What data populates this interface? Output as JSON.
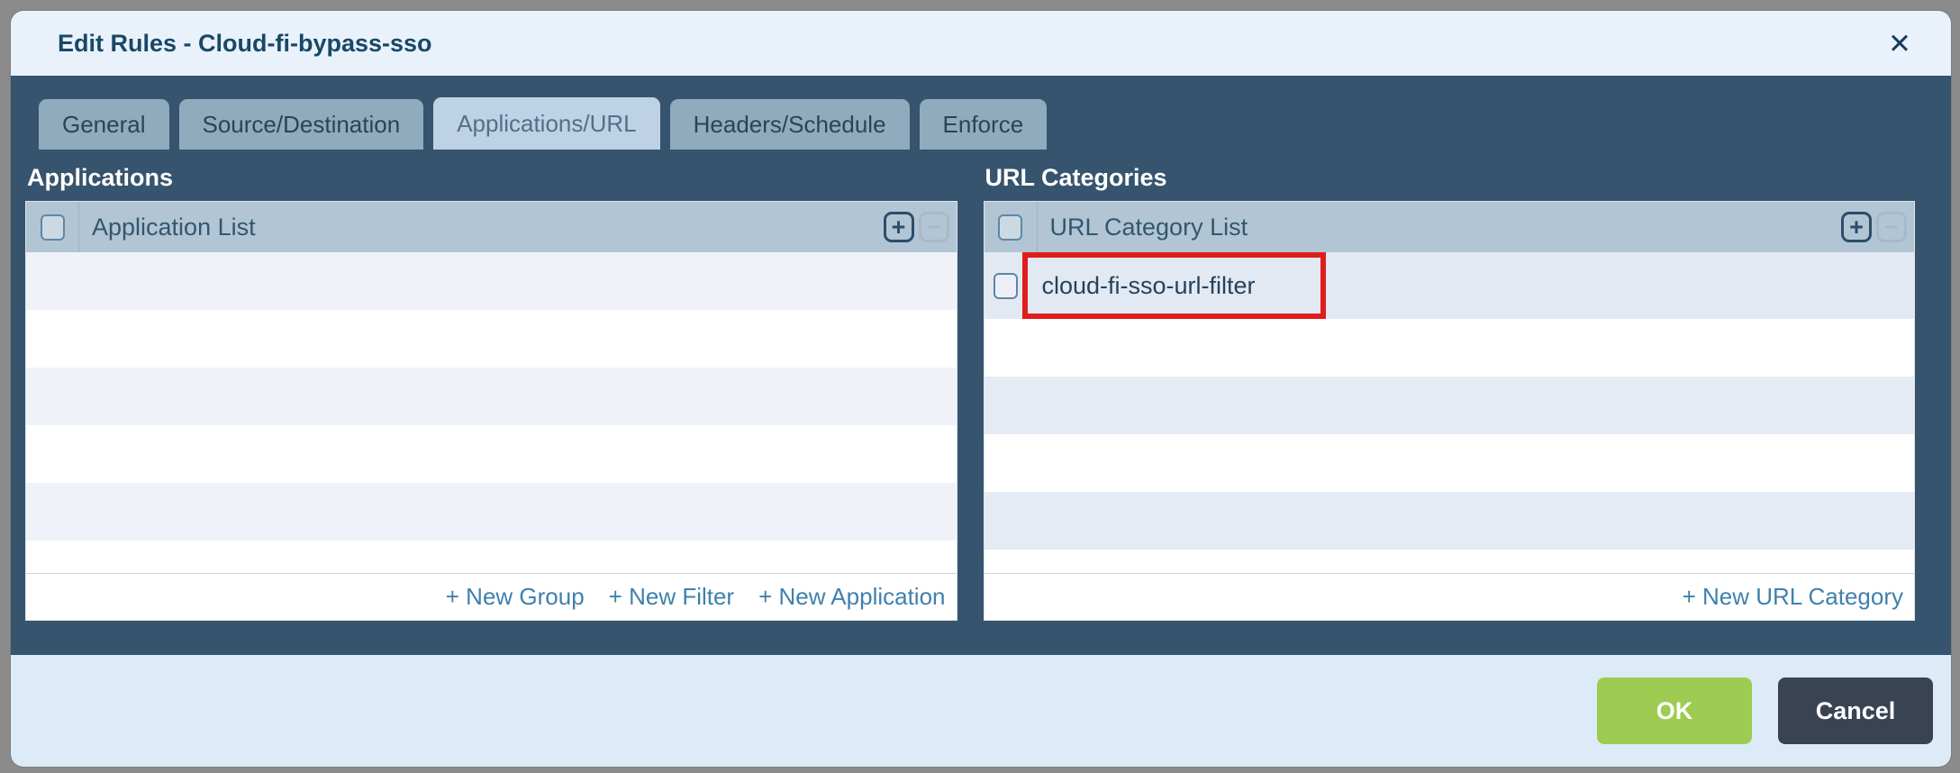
{
  "dialog": {
    "title": "Edit Rules - Cloud-fi-bypass-sso",
    "close_glyph": "✕"
  },
  "tabs": [
    {
      "label": "General",
      "active": false
    },
    {
      "label": "Source/Destination",
      "active": false
    },
    {
      "label": "Applications/URL",
      "active": true
    },
    {
      "label": "Headers/Schedule",
      "active": false
    },
    {
      "label": "Enforce",
      "active": false
    }
  ],
  "applications": {
    "section_label": "Applications",
    "list_header": "Application List",
    "add_glyph": "+",
    "remove_glyph": "−",
    "items": [],
    "footer_links": [
      "+ New Group",
      "+ New Filter",
      "+ New Application"
    ]
  },
  "url_categories": {
    "section_label": "URL Categories",
    "list_header": "URL Category List",
    "add_glyph": "+",
    "remove_glyph": "−",
    "items": [
      {
        "label": "cloud-fi-sso-url-filter",
        "highlighted": true
      }
    ],
    "footer_links": [
      "+ New URL Category"
    ]
  },
  "footer": {
    "ok_label": "OK",
    "cancel_label": "Cancel"
  },
  "colors": {
    "highlight_red": "#df1d1d",
    "ok_green": "#9ecb51",
    "cancel_dark": "#3a4351",
    "link_blue": "#3f80ad",
    "slate_background": "#36546d",
    "active_tab": "#bdd2e4"
  }
}
